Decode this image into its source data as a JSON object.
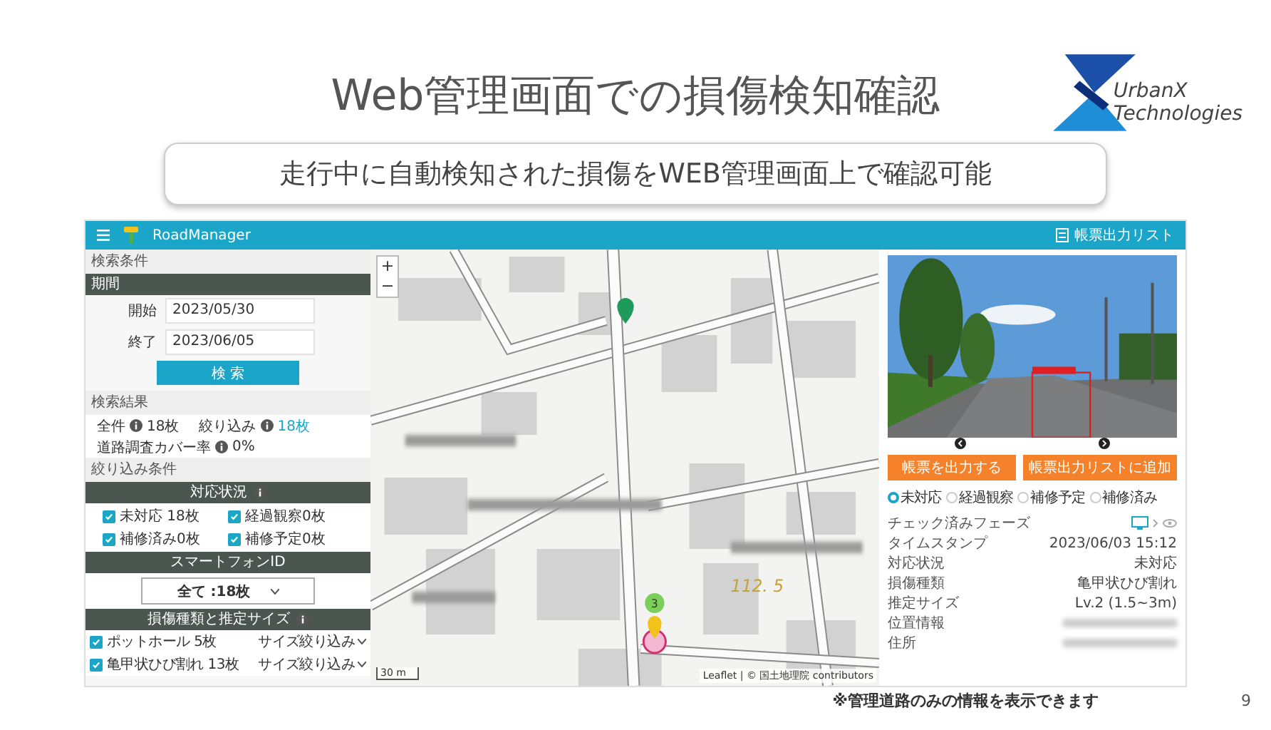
{
  "slide": {
    "title": "Web管理画面での損傷検知確認",
    "subtitle": "走行中に自動検知された損傷をWEB管理画面上で確認可能",
    "footnote": "※管理道路のみの情報を表示できます",
    "page_number": "9"
  },
  "logo": {
    "line_1": "UrbanX",
    "line_2": "Technologies"
  },
  "app": {
    "header": {
      "title": "RoadManager",
      "export_list": "帳票出力リスト"
    },
    "search": {
      "section_title": "検索条件",
      "period_header": "期間",
      "fields": [
        {
          "label": "開始",
          "value": "2023/05/30"
        },
        {
          "label": "終了",
          "value": "2023/06/05"
        }
      ],
      "button": "検 索"
    },
    "results": {
      "section_title": "検索結果",
      "total_label": "全件",
      "total_value": "18枚",
      "filtered_label": "絞り込み",
      "filtered_value": "18枚",
      "coverage_label": "道路調査カバー率",
      "coverage_value": "0%"
    },
    "filters": {
      "section_title": "絞り込み条件",
      "status_header": "対応状況",
      "status_options": [
        {
          "label": "未対応 18枚",
          "checked": true
        },
        {
          "label": "経過観察0枚",
          "checked": true
        },
        {
          "label": "補修済み0枚",
          "checked": true
        },
        {
          "label": "補修予定0枚",
          "checked": true
        }
      ],
      "phone_header": "スマートフォンID",
      "phone_select": "全て :18枚",
      "damage_header": "損傷種類と推定サイズ",
      "damage_types": [
        {
          "label": "ポットホール 5枚",
          "checked": true,
          "size_filter": "サイズ絞り込み"
        },
        {
          "label": "亀甲状ひび割れ 13枚",
          "checked": true,
          "size_filter": "サイズ絞り込み"
        }
      ]
    },
    "map": {
      "zoom_in": "+",
      "zoom_out": "−",
      "elevation_label": "112. 5",
      "cluster_count": "3",
      "scale": "30 m",
      "attribution": "Leaflet | © 国土地理院 contributors"
    },
    "detail": {
      "buttons": [
        "帳票を出力する",
        "帳票出力リストに追加"
      ],
      "status_radios": [
        {
          "label": "未対応",
          "selected": true
        },
        {
          "label": "経過観察",
          "selected": false
        },
        {
          "label": "補修予定",
          "selected": false
        },
        {
          "label": "補修済み",
          "selected": false
        }
      ],
      "rows": [
        {
          "label": "チェック済みフェーズ",
          "kind": "phase"
        },
        {
          "label": "タイムスタンプ",
          "kind": "text",
          "value": "2023/06/03 15:12"
        },
        {
          "label": "対応状況",
          "kind": "text",
          "value": "未対応"
        },
        {
          "label": "損傷種類",
          "kind": "text",
          "value": "亀甲状ひび割れ"
        },
        {
          "label": "推定サイズ",
          "kind": "text",
          "value": "Lv.2 (1.5~3m)"
        },
        {
          "label": "位置情報",
          "kind": "redacted"
        },
        {
          "label": "住所",
          "kind": "redacted"
        }
      ]
    }
  }
}
